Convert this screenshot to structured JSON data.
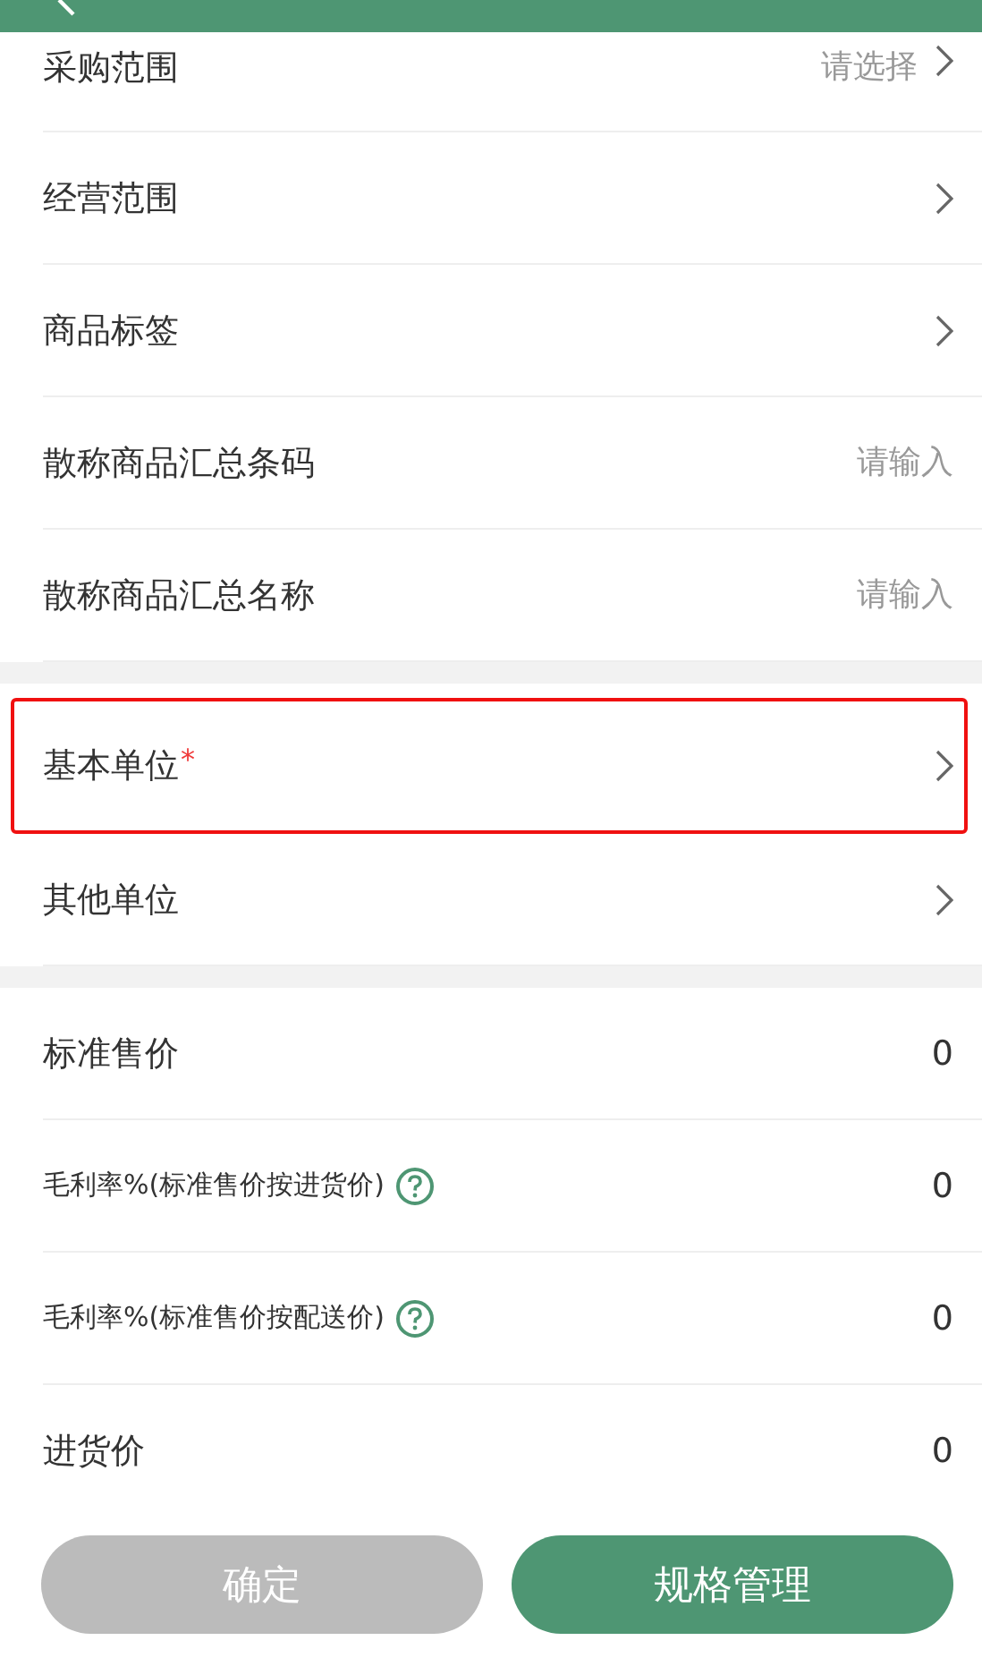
{
  "sections": [
    {
      "rows": [
        {
          "kind": "select",
          "label": "采购范围",
          "placeholder": "请选择",
          "highlighted": false
        },
        {
          "kind": "select",
          "label": "经营范围",
          "highlighted": false
        },
        {
          "kind": "select",
          "label": "商品标签",
          "highlighted": false
        },
        {
          "kind": "input",
          "label": "散称商品汇总条码",
          "placeholder": "请输入",
          "highlighted": false
        },
        {
          "kind": "input",
          "label": "散称商品汇总名称",
          "placeholder": "请输入",
          "highlighted": false
        }
      ]
    },
    {
      "rows": [
        {
          "kind": "select",
          "label": "基本单位",
          "highlighted": true,
          "required_mark": "*"
        },
        {
          "kind": "select",
          "label": "其他单位",
          "highlighted": false
        }
      ]
    },
    {
      "rows": [
        {
          "kind": "value",
          "label": "标准售价",
          "value": "0",
          "help": false,
          "small": false
        },
        {
          "kind": "value",
          "label": "毛利率%(标准售价按进货价)",
          "value": "0",
          "help": true,
          "small": true
        },
        {
          "kind": "value",
          "label": "毛利率%(标准售价按配送价)",
          "value": "0",
          "help": true,
          "small": true
        },
        {
          "kind": "value",
          "label": "进货价",
          "value": "0",
          "help": false,
          "small": false
        }
      ]
    }
  ],
  "buttons": [
    {
      "label": "确定",
      "disabled": true
    },
    {
      "label": "规格管理",
      "disabled": false
    }
  ]
}
